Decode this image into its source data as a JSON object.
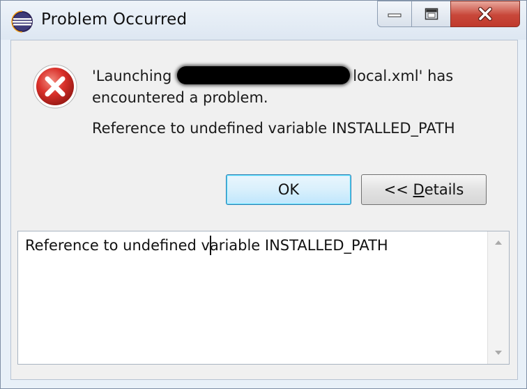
{
  "window": {
    "title": "Problem Occurred",
    "icon": "eclipse-app-icon",
    "controls": [
      "minimize-icon",
      "maximize-icon",
      "close-icon"
    ]
  },
  "message": {
    "line_start": "'Launching",
    "line_end": "local.xml' has",
    "line2": "encountered a problem.",
    "reason": "Reference to undefined variable INSTALLED_PATH",
    "icon": "error-icon"
  },
  "buttons": {
    "ok_label": "OK",
    "details_prefix": "<< ",
    "details_underlined": "D",
    "details_rest": "etails"
  },
  "details_area": {
    "text": "Reference to undefined variable INSTALLED_PATH"
  },
  "colors": {
    "error_red": "#d9302a",
    "close_button": "#c8473a",
    "dialog_bg": "#f0f0f0"
  }
}
